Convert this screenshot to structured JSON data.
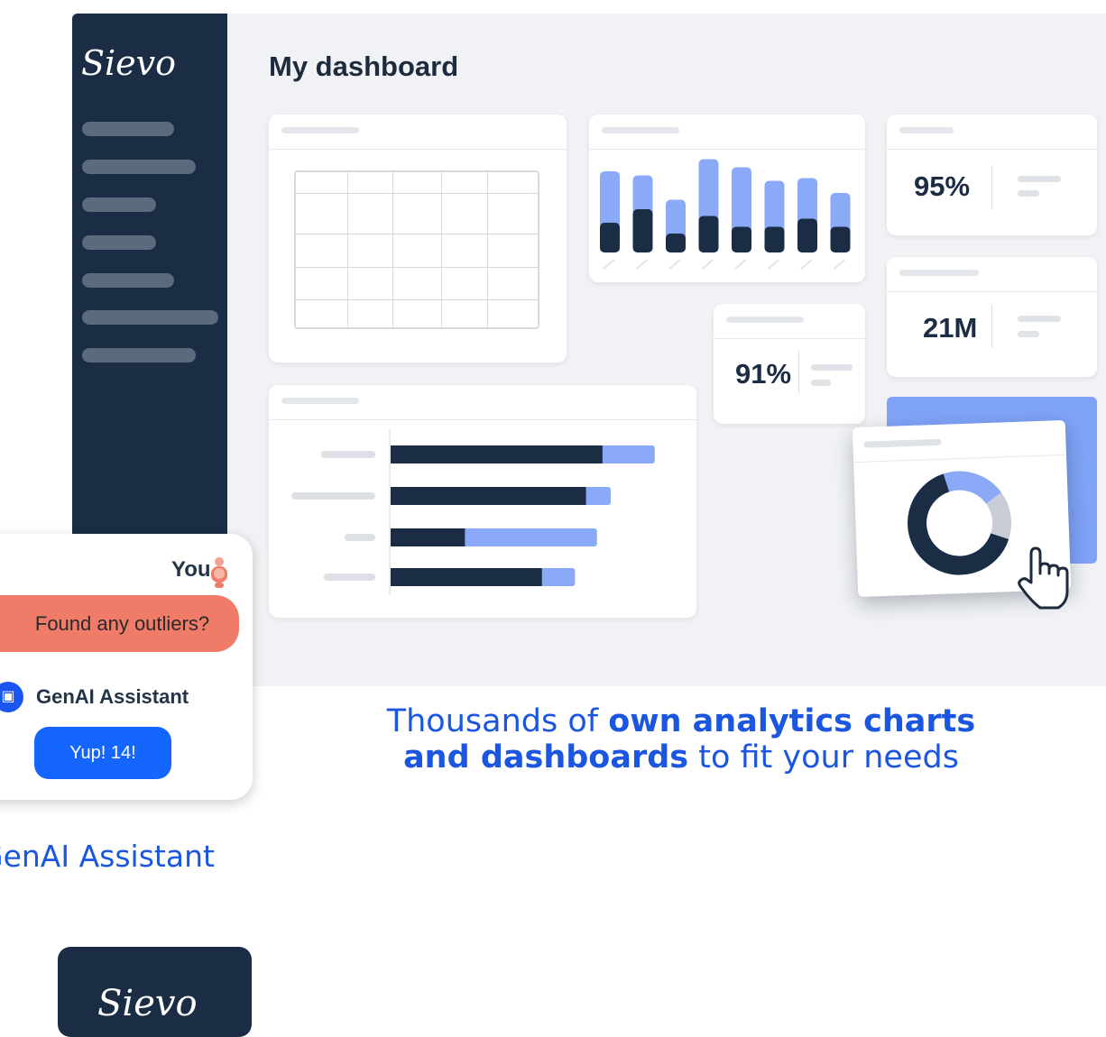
{
  "app": {
    "logo": "Sievo",
    "page_title": "My dashboard"
  },
  "kpis": [
    {
      "value": "95%"
    },
    {
      "value": "21M"
    },
    {
      "value": "91%"
    }
  ],
  "chat": {
    "user_name": "You",
    "user_message": "Found any outliers?",
    "assistant_name": "GenAI Assistant",
    "assistant_message": "Yup! 14!"
  },
  "captions": {
    "analytics_pre": "Thousands of ",
    "analytics_bold": "own analytics charts and dashboards",
    "analytics_post": " to fit your needs",
    "genai": "GenAI Assistant"
  },
  "bottom_logo": "Sievo",
  "colors": {
    "navy": "#1a2d45",
    "accent_blue": "#1466ff",
    "light_blue": "#7fa3f7",
    "coral": "#ef7b68"
  },
  "chart_data": [
    {
      "type": "bar",
      "stacked": true,
      "series": [
        {
          "values": [
            22,
            32,
            14,
            27,
            19,
            19,
            25,
            19
          ]
        },
        {
          "values": [
            38,
            25,
            25,
            42,
            44,
            34,
            30,
            25
          ]
        }
      ]
    },
    {
      "type": "bar",
      "orientation": "horizontal",
      "stacked": true,
      "series": [
        {
          "values": [
            77,
            71,
            27,
            55
          ]
        },
        {
          "values": [
            19,
            9,
            48,
            12
          ]
        }
      ]
    },
    {
      "type": "pie",
      "donut": true,
      "values": [
        65,
        20,
        15
      ]
    }
  ]
}
